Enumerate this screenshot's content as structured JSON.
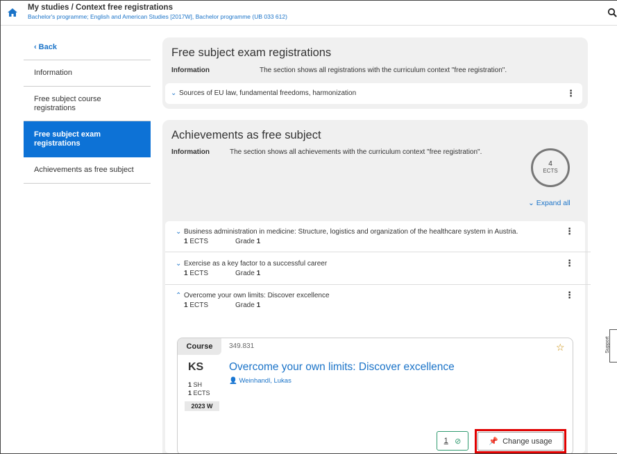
{
  "header": {
    "title": "My studies / Context free registrations",
    "subtitle": "Bachelor's programme; English and American Studies [2017W], Bachelor programme (UB 033 612)"
  },
  "sidebar": {
    "back_label": "Back",
    "items": [
      {
        "label": "Information"
      },
      {
        "label": "Free subject course registrations"
      },
      {
        "label": "Free subject exam registrations",
        "active": true
      },
      {
        "label": "Achievements as free subject"
      }
    ]
  },
  "exam_section": {
    "title": "Free subject exam registrations",
    "info_label": "Information",
    "info_text": "The section shows all registrations with the curriculum context \"free registration\".",
    "items": [
      {
        "title": "Sources of EU law, fundamental freedoms, harmonization"
      }
    ]
  },
  "achievements_section": {
    "title": "Achievements as free subject",
    "info_label": "Information",
    "info_text": "The section shows all achievements with the curriculum context \"free registration\".",
    "total_ects": "4",
    "total_unit": "ECTS",
    "expand_all": "Expand all",
    "items": [
      {
        "title": "Business administration in medicine: Structure, logistics and organization of the healthcare system in Austria.",
        "ects": "1",
        "ects_unit": "ECTS",
        "grade_label": "Grade",
        "grade": "1"
      },
      {
        "title": "Exercise as a key factor to a successful career",
        "ects": "1",
        "ects_unit": "ECTS",
        "grade_label": "Grade",
        "grade": "1"
      },
      {
        "title": "Overcome your own limits: Discover excellence",
        "ects": "1",
        "ects_unit": "ECTS",
        "grade_label": "Grade",
        "grade": "1"
      }
    ]
  },
  "course_card": {
    "tag": "Course",
    "number": "349.831",
    "type": "KS",
    "title": "Overcome your own limits: Discover excellence",
    "lecturer": "Weinhandl, Lukas",
    "sh": "1",
    "sh_unit": "SH",
    "ects": "1",
    "ects_unit": "ECTS",
    "semester": "2023 W",
    "count": "1",
    "change_usage": "Change usage"
  },
  "support_label": "Support",
  "colors": {
    "accent": "#0d72d6",
    "highlight": "#e00000",
    "success": "#2f9a6f"
  }
}
